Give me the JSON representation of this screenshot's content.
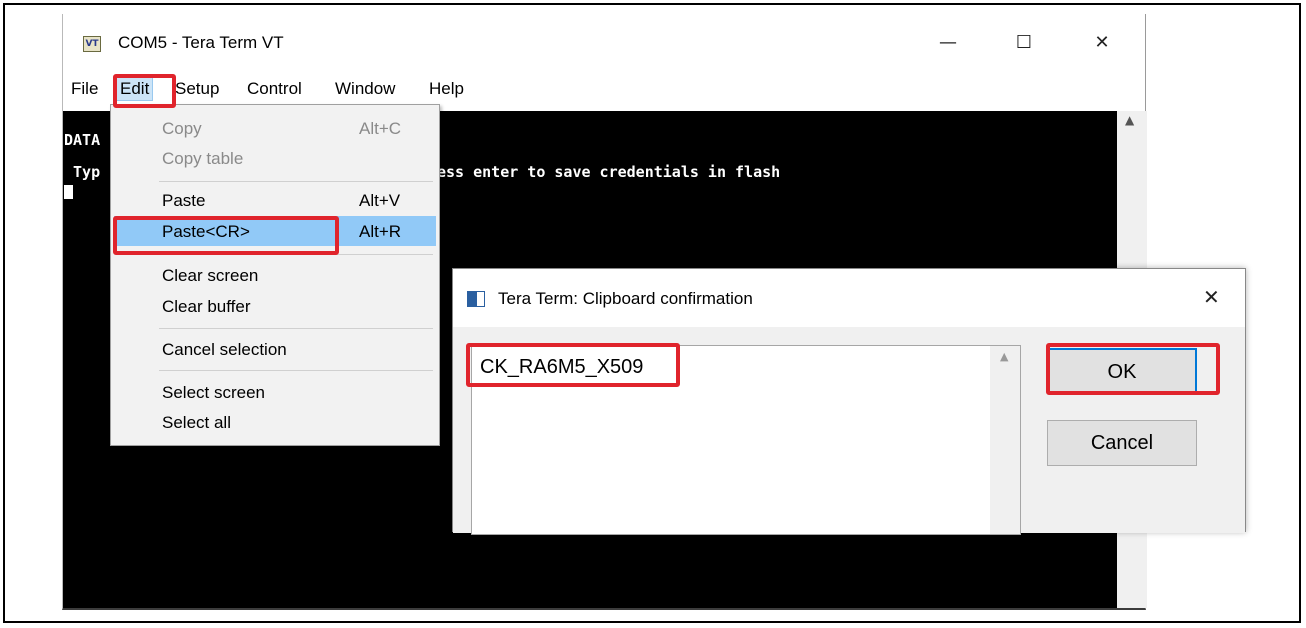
{
  "window": {
    "icon_label": "VT",
    "title": "COM5 - Tera Term VT",
    "minimize": "—",
    "maximize": "☐",
    "close": "✕"
  },
  "menubar": [
    "File",
    "Edit",
    "Setup",
    "Control",
    "Window",
    "Help"
  ],
  "terminal": {
    "line1": "DATA",
    "line2_left": " Typ",
    "line2_right": "ess enter to save credentials in flash"
  },
  "edit_menu": {
    "items": [
      {
        "label": "Copy",
        "shortcut": "Alt+C"
      },
      {
        "label": "Copy table",
        "shortcut": ""
      },
      {
        "label": "Paste",
        "shortcut": "Alt+V"
      },
      {
        "label": "Paste<CR>",
        "shortcut": "Alt+R"
      },
      {
        "label": "Clear screen",
        "shortcut": ""
      },
      {
        "label": "Clear buffer",
        "shortcut": ""
      },
      {
        "label": "Cancel selection",
        "shortcut": ""
      },
      {
        "label": "Select screen",
        "shortcut": ""
      },
      {
        "label": "Select all",
        "shortcut": ""
      }
    ]
  },
  "dialog": {
    "title": "Tera Term: Clipboard confirmation",
    "close": "✕",
    "clipboard_text": "CK_RA6M5_X509",
    "ok_label": "OK",
    "cancel_label": "Cancel"
  },
  "colors": {
    "highlight_box": "#e0242c",
    "menu_highlight": "#91c9f7",
    "terminal_bg": "#000000"
  }
}
